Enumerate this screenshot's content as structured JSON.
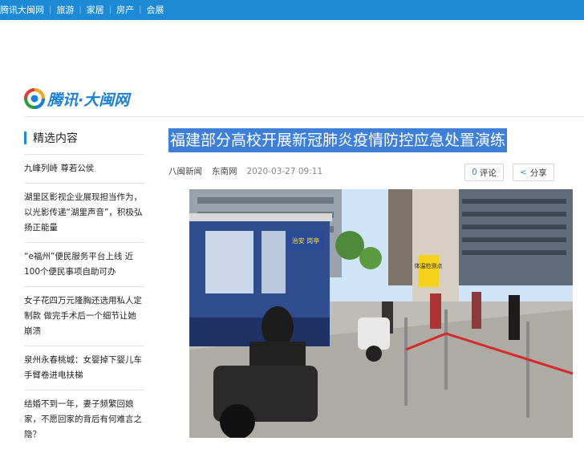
{
  "topnav": [
    "腾讯大闽网",
    "旅游",
    "家居",
    "房产",
    "会展"
  ],
  "logo": {
    "text": "腾讯·大闽网"
  },
  "sidebar": {
    "title": "精选内容",
    "items": [
      "九峰列峙 尊若公侯",
      "湖里区影视企业展现担当作为，以光影传递“湖里声音”，积极弘扬正能量",
      "“e福州”便民服务平台上线 近100个便民事项自助可办",
      "女子花四万元隆胸还选用私人定制款 做完手术后一个细节让她崩溃",
      "泉州永春桃城：女婴掉下婴儿车手臂卷进电扶梯",
      "结婚不到一年，妻子频繁回娘家，不愿回家的背后有何难言之隐？"
    ]
  },
  "article": {
    "headline": "福建部分高校开展新冠肺炎疫情防控应急处置演练",
    "source1": "八闽新闻",
    "source2": "东南网",
    "time": "2020-03-27 09:11",
    "comment_count": "0",
    "comment_label": "评论",
    "share_label": "分享"
  },
  "photo": {
    "booth_sign": "治安 岗亭",
    "sign_board": "体温检测点"
  },
  "colors": {
    "topbar": "#1e8ad6",
    "headline_bg": "#3d7fd9"
  }
}
